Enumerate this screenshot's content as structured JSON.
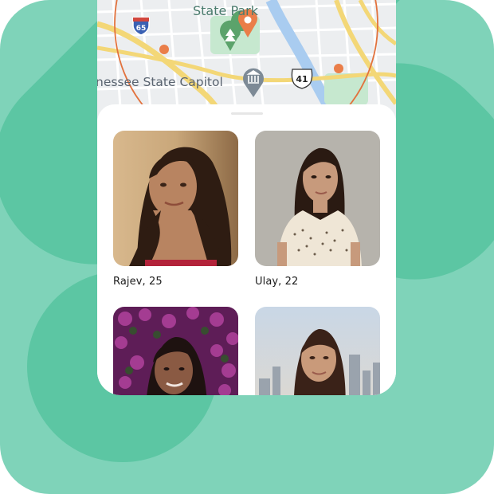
{
  "map": {
    "park_label": "State Park",
    "capitol_label": "nessee State Capitol",
    "interstate_shield": "65",
    "us_route_shield": "41",
    "icons": [
      "tree-pin-icon",
      "location-pin-icon",
      "museum-pin-icon"
    ],
    "colors": {
      "radius_circle": "#e2723d",
      "marker": "#ea7e49",
      "park": "#5ba36b"
    }
  },
  "profiles": [
    {
      "caption": "Rajev, 25"
    },
    {
      "caption": "Ulay, 22"
    },
    {
      "caption": ""
    },
    {
      "caption": ""
    }
  ],
  "theme": {
    "background": "#7fd3b9",
    "accent": "#5cc6a3"
  }
}
